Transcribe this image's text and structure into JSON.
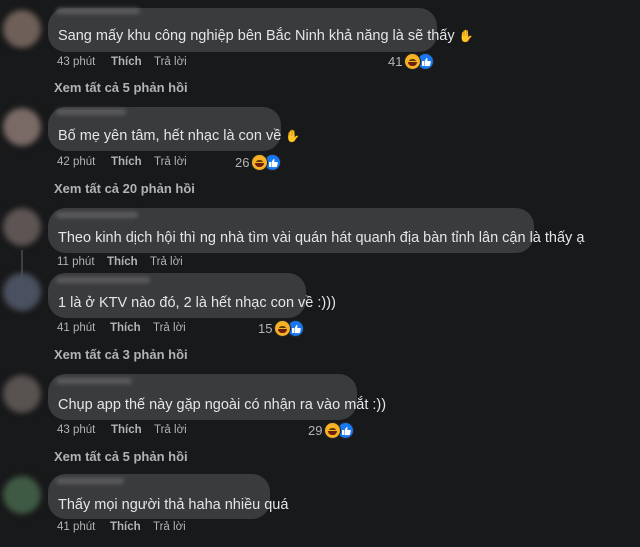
{
  "comments": [
    {
      "text": "Sang mấy khu công nghiệp bên Bắc Ninh khả năng là sẽ thấy",
      "time": "43 phút",
      "like": "Thích",
      "reply": "Trả lời",
      "count": "41",
      "reactions": [
        "haha",
        "like"
      ],
      "replies": "Xem tất cả 5 phản hồi"
    },
    {
      "text": "Bố mẹ yên tâm, hết nhạc là con về",
      "time": "42 phút",
      "like": "Thích",
      "reply": "Trả lời",
      "count": "26",
      "reactions": [
        "haha",
        "like"
      ],
      "replies": "Xem tất cả 20 phản hồi"
    },
    {
      "text": "Theo kinh dịch hội thì ng nhà tìm vài quán hát quanh địa bàn tỉnh lân cận là thấy ạ",
      "time": "11 phút",
      "like": "Thích",
      "reply": "Trả lời"
    },
    {
      "text": "1 là ở KTV nào đó, 2 là hết nhạc con về :)))",
      "time": "41 phút",
      "like": "Thích",
      "reply": "Trả lời",
      "count": "15",
      "reactions": [
        "haha",
        "like"
      ],
      "replies": "Xem tất cả 3 phản hồi"
    },
    {
      "text": "Chụp app thế này gặp ngoài có nhận ra vào mắt :))",
      "time": "43 phút",
      "like": "Thích",
      "reply": "Trả lời",
      "count": "29",
      "reactions": [
        "haha",
        "like"
      ],
      "replies": "Xem tất cả 5 phản hồi"
    },
    {
      "text": "Thấy mọi người thả haha nhiều quá",
      "time": "41 phút",
      "like": "Thích",
      "reply": "Trả lời"
    }
  ],
  "colors": {
    "background": "#18191a",
    "bubble": "#3a3b3c",
    "meta": "#b0b3b8",
    "like_blue": "#1877f2",
    "haha_yellow": "#f7b125"
  }
}
